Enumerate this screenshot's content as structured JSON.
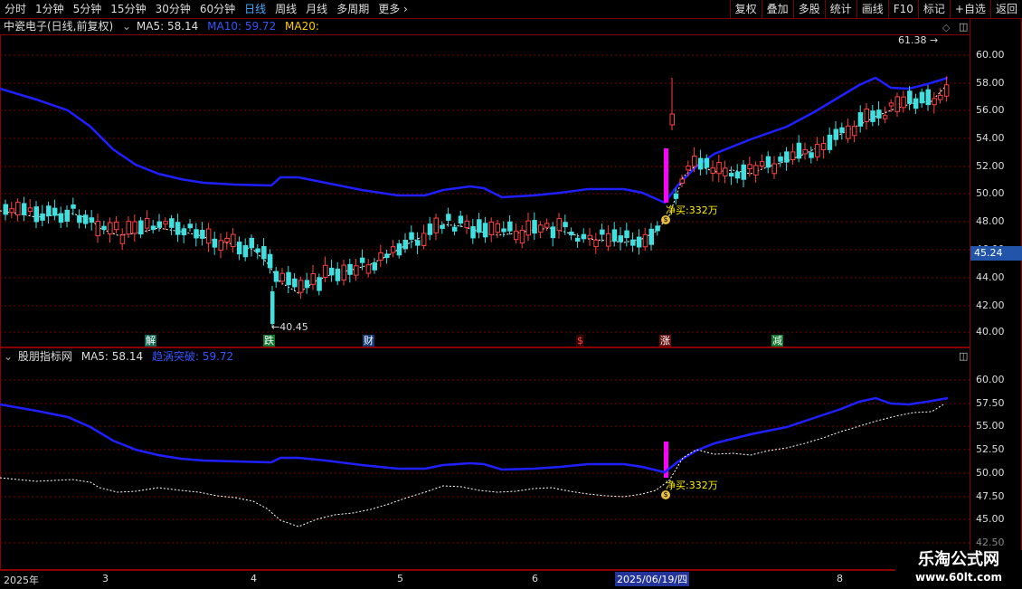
{
  "toolbar": {
    "periods": [
      "分时",
      "1分钟",
      "5分钟",
      "15分钟",
      "30分钟",
      "60分钟",
      "日线",
      "周线",
      "月线",
      "多周期",
      "更多"
    ],
    "active_period": "日线",
    "right_buttons": [
      "复权",
      "叠加",
      "多股",
      "统计",
      "画线",
      "F10",
      "标记",
      "+自选",
      "返回"
    ]
  },
  "main_pane": {
    "stock_title": "中瓷电子(日线,前复权)",
    "ma5": "MA5: 58.14",
    "ma10": "MA10: 59.72",
    "ma20": "MA20:",
    "high_marker": "61.38",
    "low_marker": "40.45",
    "net_buy": "净买:332万",
    "current_price": "45.24",
    "y_ticks": [
      "60.00",
      "58.00",
      "56.00",
      "54.00",
      "52.00",
      "50.00",
      "48.00",
      "46.00",
      "44.00",
      "42.00",
      "40.00"
    ],
    "events": [
      {
        "label": "解",
        "color": "#ffffff",
        "bg": "#116655"
      },
      {
        "label": "跌",
        "color": "#ffffff",
        "bg": "#11772e"
      },
      {
        "label": "财",
        "color": "#ffffff",
        "bg": "#113a77"
      },
      {
        "label": "$",
        "color": "#ff4444",
        "bg": "#330000"
      },
      {
        "label": "涨",
        "color": "#ffffff",
        "bg": "#661111"
      },
      {
        "label": "减",
        "color": "#ffffff",
        "bg": "#11772e"
      }
    ]
  },
  "sub_pane": {
    "title": "股朋指标网",
    "ma5": "MA5: 58.14",
    "line2": "趋涡突破: 59.72",
    "net_buy": "净买:332万",
    "y_ticks": [
      "60.00",
      "57.50",
      "55.00",
      "52.50",
      "50.00",
      "47.50",
      "45.00",
      "42.50"
    ]
  },
  "date_axis": {
    "labels": [
      "2025年",
      "3",
      "4",
      "5",
      "6",
      "7",
      "8"
    ],
    "selected": "2025/06/19/四"
  },
  "watermark": {
    "line1": "乐淘公式网",
    "line2": "www.60lt.com"
  },
  "colors": {
    "up": "#ff4040",
    "down": "#40e0e0",
    "band": "#1f1fff",
    "signal": "#ff00ff",
    "grid": "#880000"
  }
}
